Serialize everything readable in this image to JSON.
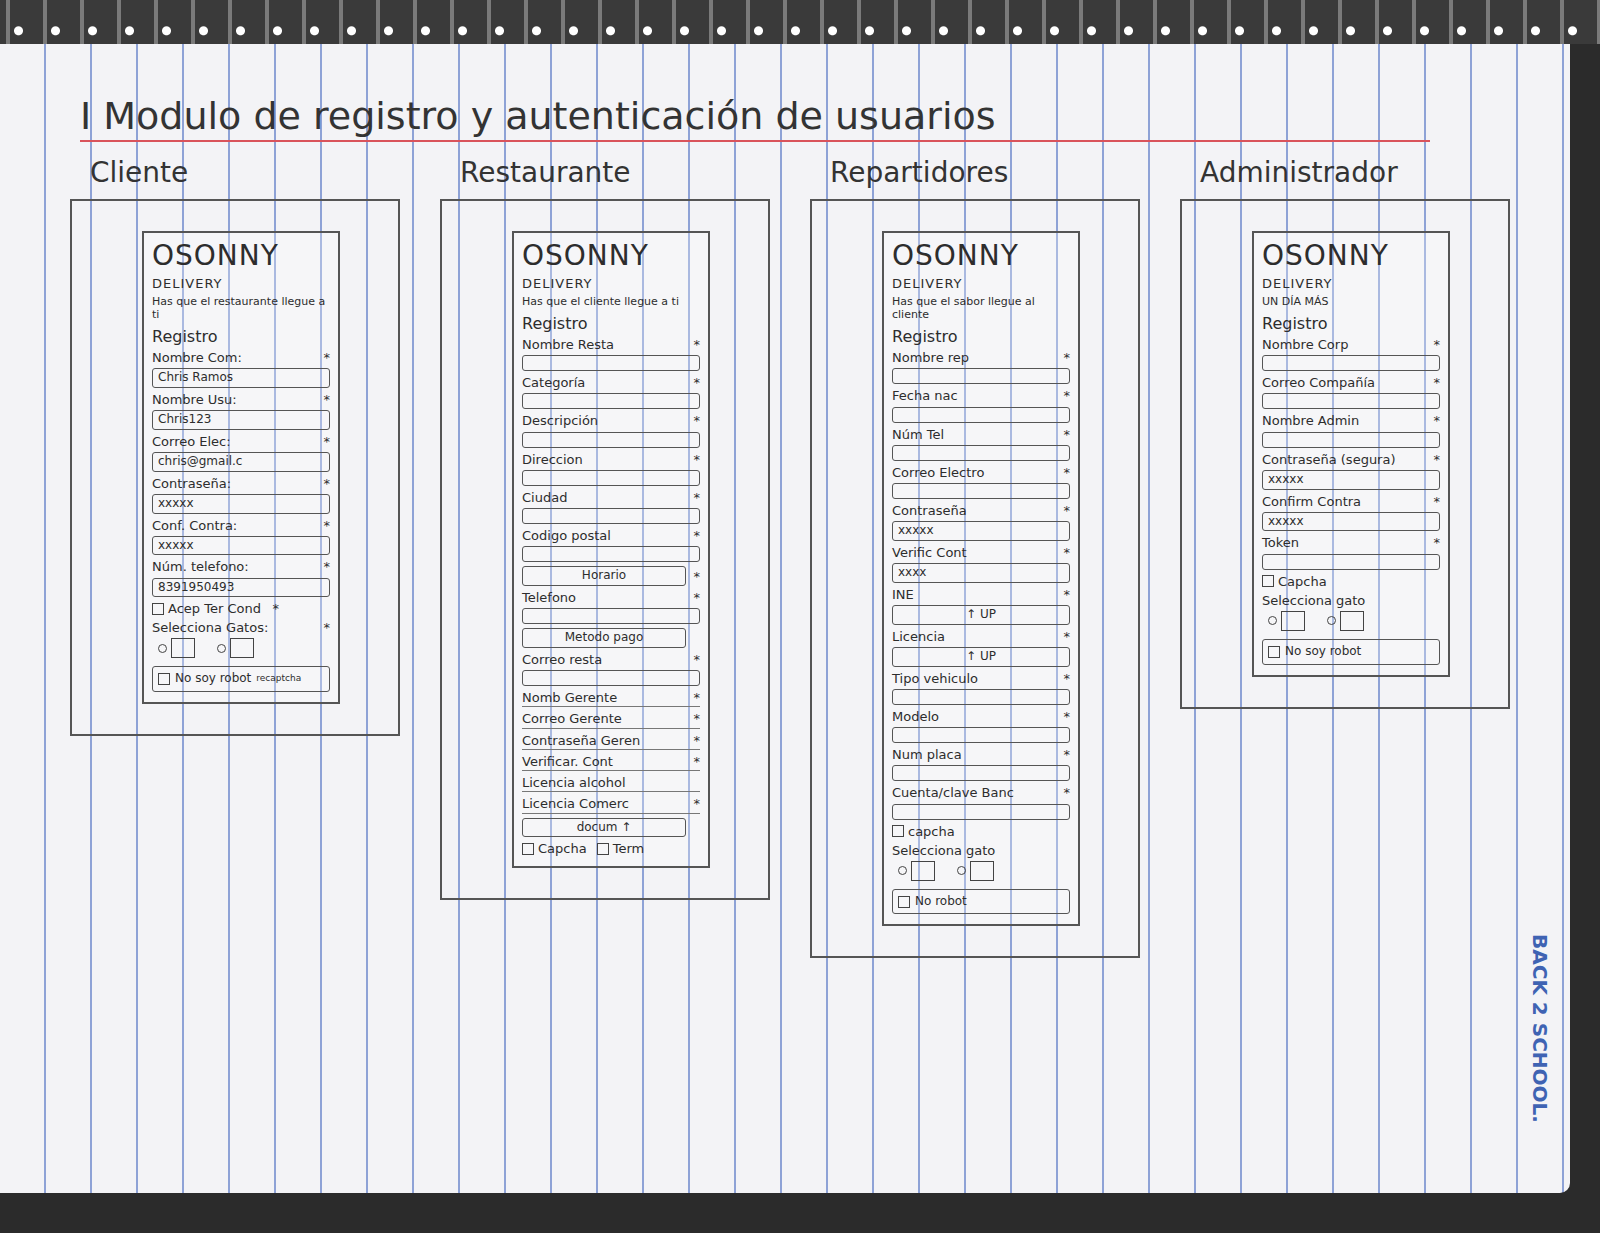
{
  "title": "I Modulo de registro y autenticación de usuarios",
  "brand": "BACK 2 SCHOOL.",
  "columns": [
    {
      "label": "Cliente",
      "phone": {
        "logo": "OSONNY",
        "sub": "DELIVERY",
        "slogan": "Has que el restaurante llegue a ti",
        "heading": "Registro",
        "fields": [
          {
            "kind": "input",
            "label": "Nombre Com:",
            "value": "Chris Ramos",
            "mark": "*"
          },
          {
            "kind": "input",
            "label": "Nombre Usu:",
            "value": "Chris123",
            "mark": "*"
          },
          {
            "kind": "input",
            "label": "Correo Elec:",
            "value": "chris@gmail.c",
            "mark": "*"
          },
          {
            "kind": "input",
            "label": "Contraseña:",
            "value": "xxxxx",
            "mark": "*"
          },
          {
            "kind": "input",
            "label": "Conf. Contra:",
            "value": "xxxxx",
            "mark": "*"
          },
          {
            "kind": "input",
            "label": "Núm. telefono:",
            "value": "8391950493",
            "mark": "*"
          },
          {
            "kind": "checks",
            "mark": "*",
            "items": [
              {
                "label": "Acep Ter Cond",
                "checked": false
              }
            ]
          },
          {
            "kind": "choice",
            "label": "Selecciona Gatos:",
            "mark": "*",
            "options": [
              {
                "checked": false
              },
              {
                "checked": false
              }
            ]
          },
          {
            "kind": "robot",
            "label": "No soy robot",
            "value": "recaptcha",
            "checked": false
          }
        ]
      }
    },
    {
      "label": "Restaurante",
      "phone": {
        "logo": "OSONNY",
        "sub": "DELIVERY",
        "slogan": "Has que el cliente llegue a ti",
        "heading": "Registro",
        "fields": [
          {
            "kind": "input",
            "label": "Nombre Resta",
            "value": "",
            "mark": "*"
          },
          {
            "kind": "input",
            "label": "Categoría",
            "value": "",
            "mark": "*"
          },
          {
            "kind": "input",
            "label": "Descripción",
            "value": "",
            "mark": "*"
          },
          {
            "kind": "input",
            "label": "Direccion",
            "value": "",
            "mark": "*"
          },
          {
            "kind": "input",
            "label": "Ciudad",
            "value": "",
            "mark": "*"
          },
          {
            "kind": "input",
            "label": "Codigo postal",
            "value": "",
            "mark": "*"
          },
          {
            "kind": "button",
            "label": "Horario",
            "mark": "*"
          },
          {
            "kind": "input",
            "label": "Telefono",
            "value": "",
            "mark": "*"
          },
          {
            "kind": "button",
            "label": "Metodo pago",
            "mark": ""
          },
          {
            "kind": "input",
            "label": "Correo resta",
            "value": "",
            "mark": "*"
          },
          {
            "kind": "text",
            "label": "Nomb Gerente",
            "mark": "*"
          },
          {
            "kind": "text",
            "label": "Correo Gerente",
            "mark": "*"
          },
          {
            "kind": "text",
            "label": "Contraseña Geren",
            "mark": "*"
          },
          {
            "kind": "text",
            "label": "Verificar. Cont",
            "mark": "*"
          },
          {
            "kind": "text",
            "label": "Licencia alcohol",
            "mark": ""
          },
          {
            "kind": "text",
            "label": "Licencia Comerc",
            "mark": "*"
          },
          {
            "kind": "button",
            "label": "docum ↑",
            "mark": ""
          },
          {
            "kind": "checks",
            "mark": "",
            "items": [
              {
                "label": "Capcha",
                "checked": false
              },
              {
                "label": "Term",
                "checked": false
              }
            ]
          }
        ]
      }
    },
    {
      "label": "Repartidores",
      "phone": {
        "logo": "OSONNY",
        "sub": "DELIVERY",
        "slogan": "Has que el sabor llegue al cliente",
        "heading": "Registro",
        "fields": [
          {
            "kind": "input",
            "label": "Nombre rep",
            "value": "",
            "mark": "*"
          },
          {
            "kind": "input",
            "label": "Fecha nac",
            "value": "",
            "mark": "*"
          },
          {
            "kind": "input",
            "label": "Núm Tel",
            "value": "",
            "mark": "*"
          },
          {
            "kind": "input",
            "label": "Correo Electro",
            "value": "",
            "mark": "*"
          },
          {
            "kind": "input",
            "label": "Contraseña",
            "value": "xxxxx",
            "mark": "*"
          },
          {
            "kind": "input",
            "label": "Verific Cont",
            "value": "xxxx",
            "mark": "*"
          },
          {
            "kind": "upload",
            "label": "INE",
            "value": "↑ UP",
            "mark": "*"
          },
          {
            "kind": "upload",
            "label": "Licencia",
            "value": "↑ UP",
            "mark": "*"
          },
          {
            "kind": "input",
            "label": "Tipo vehiculo",
            "value": "",
            "mark": "*"
          },
          {
            "kind": "input",
            "label": "Modelo",
            "value": "",
            "mark": "*"
          },
          {
            "kind": "input",
            "label": "Num placa",
            "value": "",
            "mark": "*"
          },
          {
            "kind": "input",
            "label": "Cuenta/clave Banc",
            "value": "",
            "mark": "*"
          },
          {
            "kind": "checks",
            "mark": "",
            "items": [
              {
                "label": "capcha",
                "checked": false
              }
            ]
          },
          {
            "kind": "choice",
            "label": "Selecciona gato",
            "mark": "",
            "options": [
              {
                "checked": false
              },
              {
                "checked": false
              }
            ]
          },
          {
            "kind": "robot",
            "label": "No robot",
            "value": "",
            "checked": false
          }
        ]
      }
    },
    {
      "label": "Administrador",
      "phone": {
        "logo": "OSONNY",
        "sub": "DELIVERY",
        "slogan": "UN DÍA MÁS",
        "heading": "Registro",
        "fields": [
          {
            "kind": "input",
            "label": "Nombre Corp",
            "value": "",
            "mark": "*"
          },
          {
            "kind": "input",
            "label": "Correo Compañía",
            "value": "",
            "mark": "*"
          },
          {
            "kind": "input",
            "label": "Nombre Admin",
            "value": "",
            "mark": "*"
          },
          {
            "kind": "input",
            "label": "Contraseña (segura)",
            "value": "xxxxx",
            "mark": "*"
          },
          {
            "kind": "input",
            "label": "Confirm Contra",
            "value": "xxxxx",
            "mark": "*"
          },
          {
            "kind": "input",
            "label": "Token",
            "value": "",
            "mark": "*"
          },
          {
            "kind": "checks",
            "mark": "",
            "items": [
              {
                "label": "Capcha",
                "checked": false
              }
            ]
          },
          {
            "kind": "choice",
            "label": "Selecciona gato",
            "mark": "",
            "options": [
              {
                "checked": false
              },
              {
                "checked": false
              }
            ]
          },
          {
            "kind": "robot",
            "label": "No soy robot",
            "value": "",
            "checked": false
          }
        ]
      }
    }
  ]
}
